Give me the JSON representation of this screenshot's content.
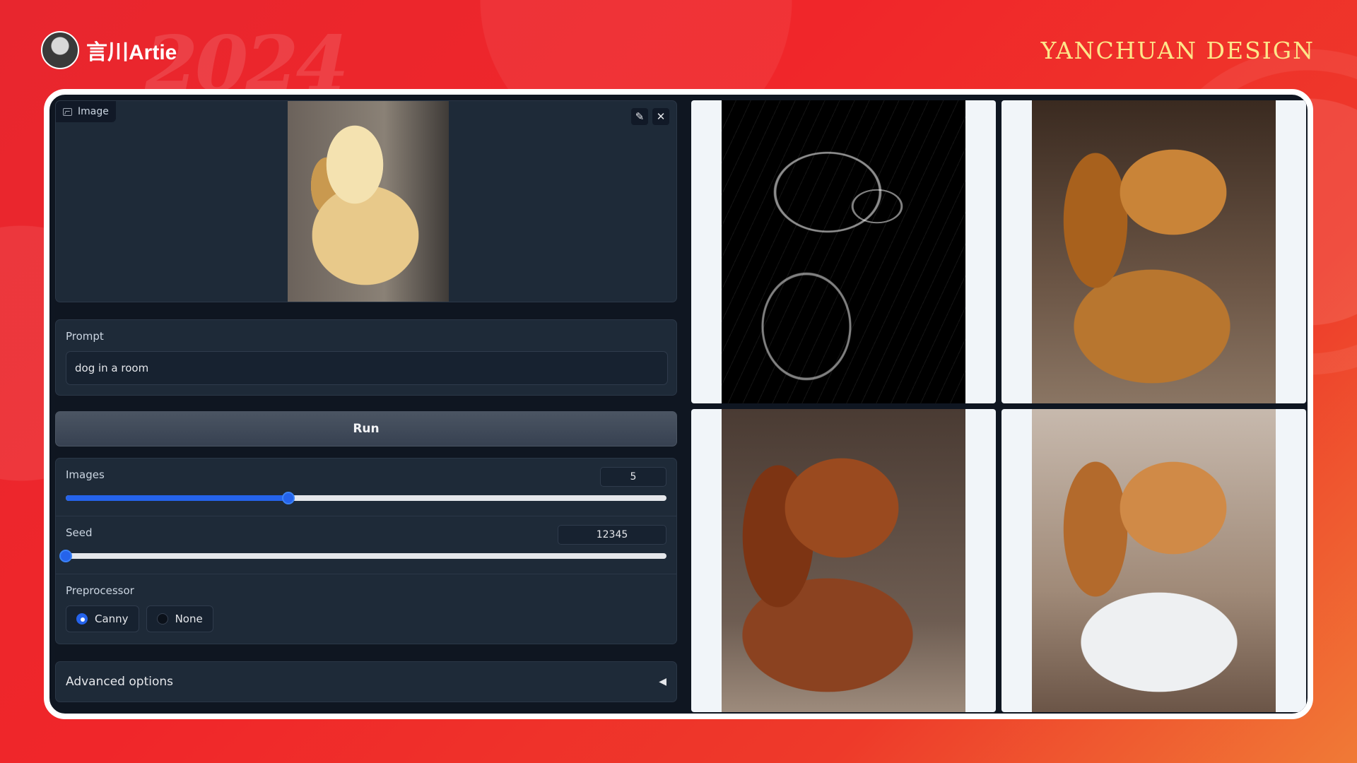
{
  "brand": {
    "name": "言川Artie",
    "design_mark": "YANCHUAN DESIGN",
    "year_mark": "2024"
  },
  "image_input": {
    "label": "Image",
    "edit_icon": "pencil-icon",
    "clear_icon": "close-icon"
  },
  "prompt": {
    "label": "Prompt",
    "value": "dog in a room"
  },
  "run": {
    "label": "Run"
  },
  "images_slider": {
    "label": "Images",
    "value": "5",
    "fraction": 0.37
  },
  "seed_slider": {
    "label": "Seed",
    "value": "12345",
    "fraction": 0.0
  },
  "preprocessor": {
    "label": "Preprocessor",
    "options": [
      {
        "label": "Canny",
        "selected": true
      },
      {
        "label": "None",
        "selected": false
      }
    ]
  },
  "advanced": {
    "label": "Advanced options",
    "caret": "◀"
  },
  "gallery": [
    "canny-edge-map",
    "dog-output-1",
    "dog-output-2",
    "dog-output-3"
  ],
  "colors": {
    "accent": "#2563eb",
    "panel": "#1e2a38",
    "frame_bg": "#0f1621"
  }
}
